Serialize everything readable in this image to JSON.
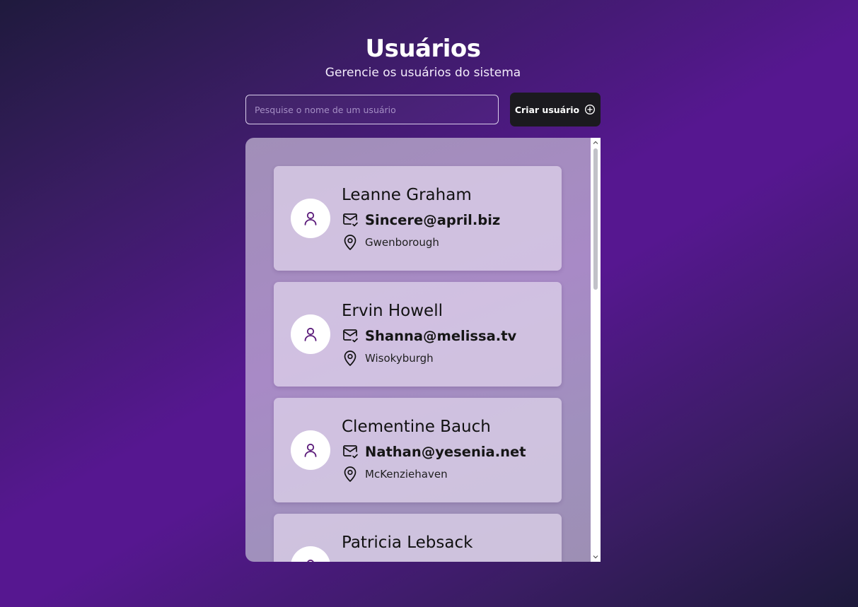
{
  "header": {
    "title": "Usuários",
    "subtitle": "Gerencie os usuários do sistema"
  },
  "search": {
    "placeholder": "Pesquise o nome de um usuário",
    "value": ""
  },
  "create_button": {
    "label": "Criar usuário",
    "icon": "plus-circle-icon"
  },
  "users": [
    {
      "name": "Leanne Graham",
      "email": "Sincere@april.biz",
      "city": "Gwenborough"
    },
    {
      "name": "Ervin Howell",
      "email": "Shanna@melissa.tv",
      "city": "Wisokyburgh"
    },
    {
      "name": "Clementine Bauch",
      "email": "Nathan@yesenia.net",
      "city": "McKenziehaven"
    },
    {
      "name": "Patricia Lebsack",
      "email": "",
      "city": ""
    }
  ],
  "icons": {
    "avatar": "user-icon",
    "email": "mail-check-icon",
    "city": "map-pin-icon"
  },
  "colors": {
    "accent": "#561790",
    "icon_purple": "#5b1b7a",
    "button_bg": "#1b1a1f"
  }
}
